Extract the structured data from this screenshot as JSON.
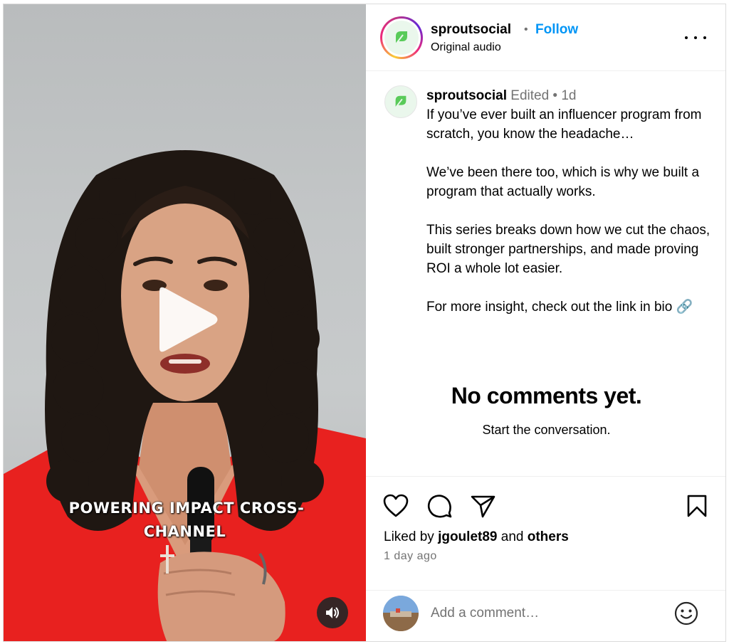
{
  "video": {
    "caption_line1": "POWERING IMPACT CROSS-",
    "caption_line2": "CHANNEL",
    "play_icon": "play-icon",
    "mute_icon": "speaker-icon"
  },
  "header": {
    "username": "sproutsocial",
    "separator": "•",
    "follow_label": "Follow",
    "audio_label": "Original audio",
    "more_icon": "more-options-icon"
  },
  "caption": {
    "username": "sproutsocial",
    "edited": "Edited",
    "dot": "•",
    "age": "1d",
    "para1": "If you’ve ever built an influencer program from scratch, you know the headache…",
    "para2": "We’ve been there too, which is why we built a program that actually works.",
    "para3": "This series breaks down how we cut the chaos, built stronger partnerships, and made proving ROI a whole lot easier.",
    "para4": "For more insight, check out the link in bio 🔗"
  },
  "comments": {
    "empty_title": "No comments yet.",
    "empty_subtitle": "Start the conversation."
  },
  "actions": {
    "like_icon": "heart-icon",
    "comment_icon": "comment-icon",
    "share_icon": "send-icon",
    "save_icon": "bookmark-icon",
    "liked_prefix": "Liked by",
    "liked_user": "jgoulet89",
    "liked_and": "and",
    "liked_others": "others",
    "timestamp": "1 day ago"
  },
  "comment_box": {
    "placeholder": "Add a comment…",
    "emoji_icon": "emoji-icon"
  },
  "colors": {
    "follow_blue": "#0095f6",
    "brand_green": "#59cb59",
    "muted_text": "#737373",
    "shirt_red": "#e8211f"
  }
}
